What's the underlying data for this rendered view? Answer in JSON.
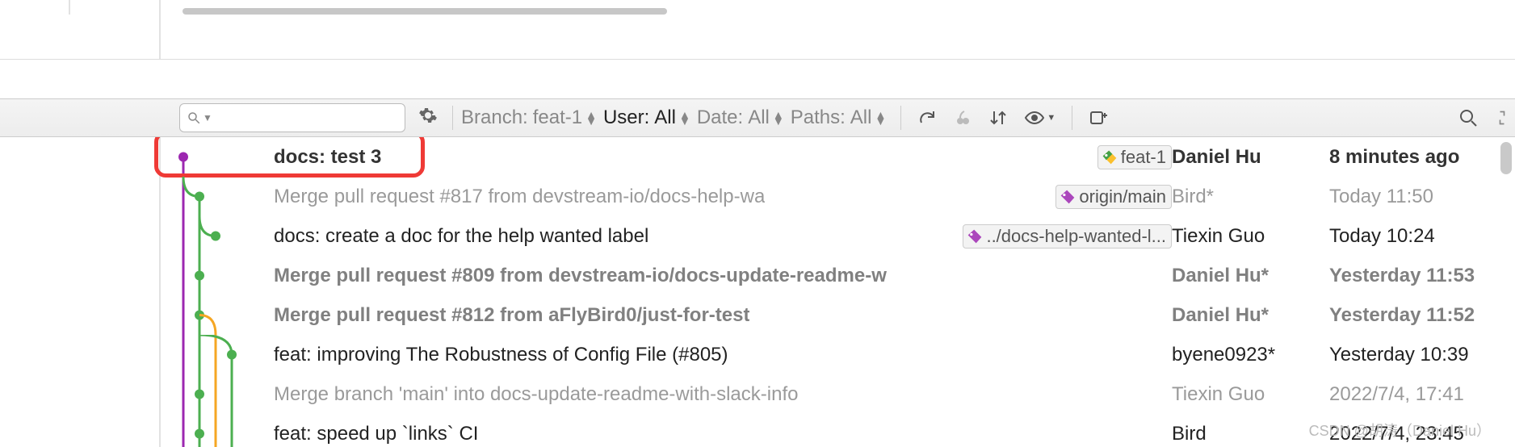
{
  "toolbar": {
    "search_placeholder": "",
    "filters": {
      "branch": {
        "label": "Branch:",
        "value": "feat-1"
      },
      "user": {
        "label": "User:",
        "value": "All"
      },
      "date": {
        "label": "Date:",
        "value": "All"
      },
      "paths": {
        "label": "Paths:",
        "value": "All"
      }
    }
  },
  "commits": [
    {
      "message": "docs: test 3",
      "tags": [
        {
          "label": "feat-1",
          "kind": "head"
        }
      ],
      "author": "Daniel Hu",
      "date": "8 minutes ago",
      "style": "bold",
      "highlighted": true
    },
    {
      "message": "Merge pull request #817 from devstream-io/docs-help-wa",
      "tags": [
        {
          "label": "origin/main",
          "kind": "remote"
        }
      ],
      "author": "Bird*",
      "date": "Today 11:50",
      "style": "merge"
    },
    {
      "message": "docs: create a doc for the help wanted label",
      "tags": [
        {
          "label": "../docs-help-wanted-l...",
          "kind": "remote"
        }
      ],
      "author": "Tiexin Guo",
      "date": "Today 10:24",
      "style": "normal"
    },
    {
      "message": "Merge pull request #809 from devstream-io/docs-update-readme-w",
      "tags": [],
      "author": "Daniel Hu*",
      "date": "Yesterday 11:53",
      "style": "boldgray"
    },
    {
      "message": "Merge pull request #812 from aFlyBird0/just-for-test",
      "tags": [],
      "author": "Daniel Hu*",
      "date": "Yesterday 11:52",
      "style": "boldgray"
    },
    {
      "message": "feat: improving The Robustness of Config File (#805)",
      "tags": [],
      "author": "byene0923*",
      "date": "Yesterday 10:39",
      "style": "normal"
    },
    {
      "message": "Merge branch 'main' into docs-update-readme-with-slack-info",
      "tags": [],
      "author": "Tiexin Guo",
      "date": "2022/7/4, 17:41",
      "style": "merge"
    },
    {
      "message": "feat: speed up `links` CI",
      "tags": [],
      "author": "Bird",
      "date": "2022/7/4, 23:45",
      "style": "normal"
    }
  ],
  "watermark": "CSDN @胡涛（Daniel Hu）"
}
